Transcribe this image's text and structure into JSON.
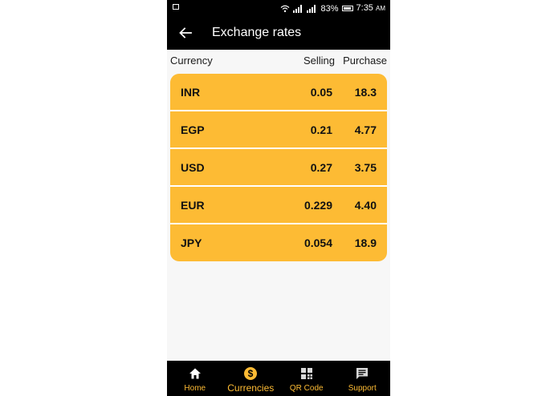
{
  "status_bar": {
    "battery": "83%",
    "time": "7:35",
    "ampm": "AM"
  },
  "app_bar": {
    "title": "Exchange rates"
  },
  "table": {
    "headers": {
      "currency": "Currency",
      "selling": "Selling",
      "purchase": "Purchase"
    },
    "rows": [
      {
        "code": "INR",
        "selling": "0.05",
        "purchase": "18.3"
      },
      {
        "code": "EGP",
        "selling": "0.21",
        "purchase": "4.77"
      },
      {
        "code": "USD",
        "selling": "0.27",
        "purchase": "3.75"
      },
      {
        "code": "EUR",
        "selling": "0.229",
        "purchase": "4.40"
      },
      {
        "code": "JPY",
        "selling": "0.054",
        "purchase": "18.9"
      }
    ]
  },
  "bottom_nav": {
    "items": [
      {
        "label": "Home",
        "icon": "home-icon"
      },
      {
        "label": "Currencies",
        "icon": "dollar-icon",
        "active": true
      },
      {
        "label": "QR Code",
        "icon": "qr-code-icon"
      },
      {
        "label": "Support",
        "icon": "chat-icon"
      }
    ]
  },
  "colors": {
    "accent": "#fdbb34",
    "bar": "#000000",
    "background": "#f7f7f7"
  }
}
